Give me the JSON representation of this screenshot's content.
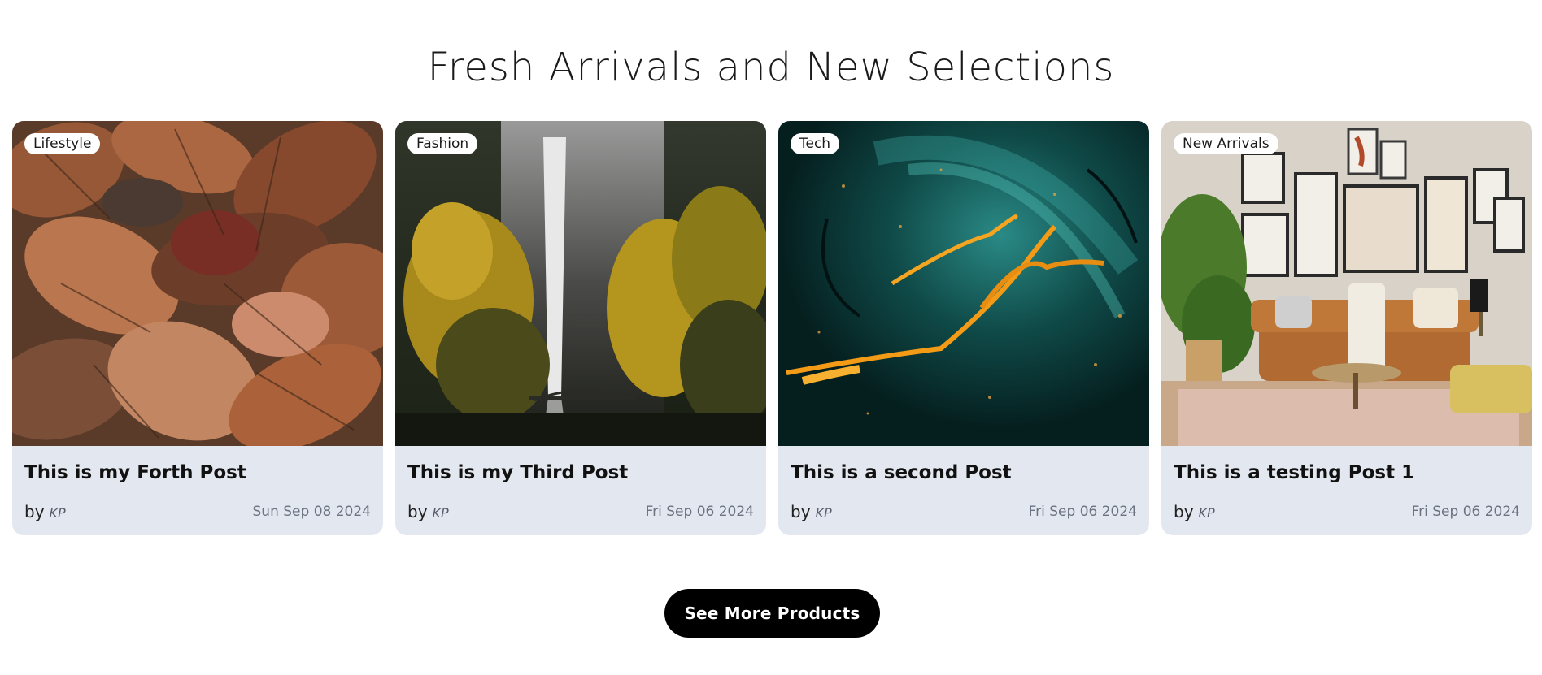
{
  "section": {
    "title": "Fresh Arrivals and New Selections"
  },
  "posts": [
    {
      "category": "Lifestyle",
      "title": "This is my Forth Post",
      "by": "by",
      "author": "KP",
      "date": "Sun Sep 08 2024",
      "image": "autumn-leaves"
    },
    {
      "category": "Fashion",
      "title": "This is my Third Post",
      "by": "by",
      "author": "KP",
      "date": "Fri Sep 06 2024",
      "image": "waterfall-forest"
    },
    {
      "category": "Tech",
      "title": "This is a second Post",
      "by": "by",
      "author": "KP",
      "date": "Fri Sep 06 2024",
      "image": "abstract-teal-orange"
    },
    {
      "category": "New Arrivals",
      "title": "This is a testing Post 1",
      "by": "by",
      "author": "KP",
      "date": "Fri Sep 06 2024",
      "image": "living-room"
    }
  ],
  "cta": {
    "label": "See More Products"
  },
  "colors": {
    "card_body": "#e3e7ef",
    "button": "#000000",
    "button_text": "#ffffff",
    "date_text": "#6b7382"
  }
}
